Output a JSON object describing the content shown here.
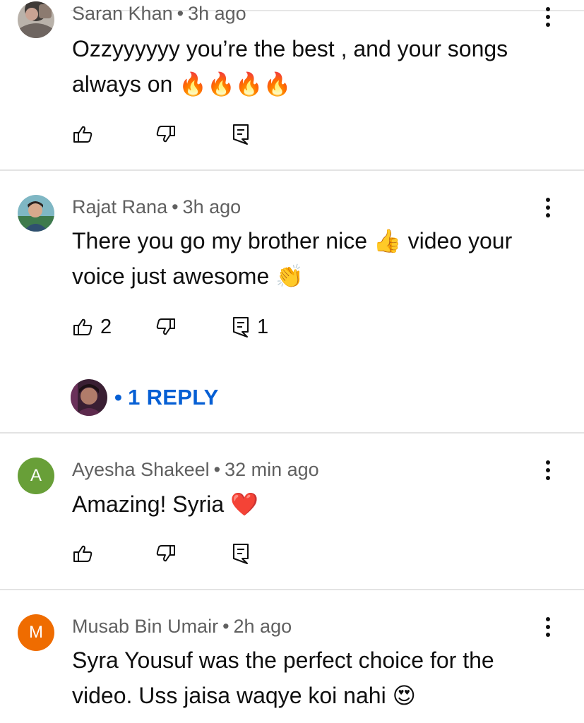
{
  "comments": [
    {
      "author": "Saran Khan",
      "time": "3h ago",
      "text": "Ozzyyyyyy you’re the best , and your songs always on 🔥🔥🔥🔥",
      "likes": "",
      "replies": ""
    },
    {
      "author": "Rajat Rana",
      "time": "3h ago",
      "text": "There you go my brother nice 👍 video your voice just awesome 👏",
      "likes": "2",
      "replies": "1",
      "reply_link": "1 REPLY"
    },
    {
      "author": "Ayesha Shakeel",
      "avatar_letter": "A",
      "avatar_color": "#689f38",
      "time": "32 min ago",
      "text": "Amazing! Syria ❤️",
      "likes": "",
      "replies": ""
    },
    {
      "author": "Musab Bin Umair",
      "avatar_letter": "M",
      "avatar_color": "#ef6c00",
      "time": "2h ago",
      "text": "Syra Yousuf was the perfect choice for the video. Uss jaisa waqye koi nahi 😍"
    }
  ],
  "separator": "•",
  "reply_separator": "•",
  "icons": {
    "like": "thumb-up-outline-icon",
    "dislike": "thumb-down-outline-icon",
    "reply": "comment-reply-icon",
    "more": "vertical-dots-icon"
  },
  "colors": {
    "link": "#065fd4",
    "meta": "#606060",
    "divider": "#e3e3e3"
  }
}
